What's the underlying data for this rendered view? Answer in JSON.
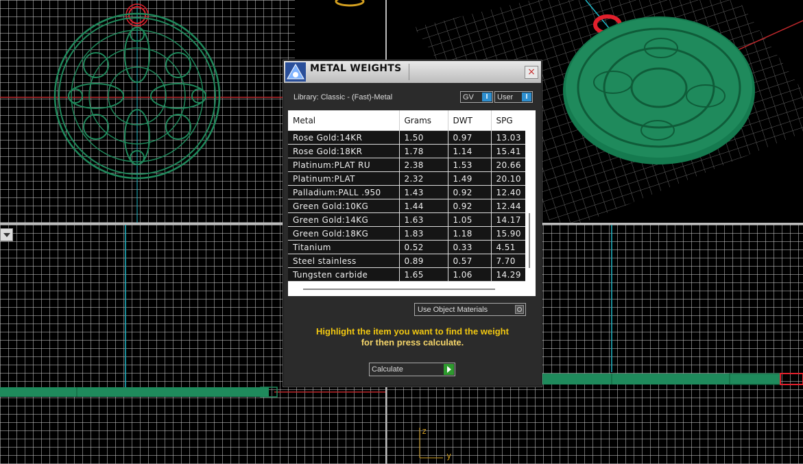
{
  "dialog": {
    "title": "METAL WEIGHTS",
    "close_glyph": "×",
    "library_label": "Library: Classic - (Fast)-Metal",
    "toggle_gv": "GV",
    "toggle_user": "User",
    "toggle_knob": "I",
    "columns": [
      "Metal",
      "Grams",
      "DWT",
      "SPG"
    ],
    "rows": [
      [
        "Rose Gold:14KR",
        "1.50",
        "0.97",
        "13.03"
      ],
      [
        "Rose Gold:18KR",
        "1.78",
        "1.14",
        "15.41"
      ],
      [
        "Platinum:PLAT RU",
        "2.38",
        "1.53",
        "20.66"
      ],
      [
        "Platinum:PLAT",
        "2.32",
        "1.49",
        "20.10"
      ],
      [
        "Palladium:PALL .950",
        "1.43",
        "0.92",
        "12.40"
      ],
      [
        "Green Gold:10KG",
        "1.44",
        "0.92",
        "12.44"
      ],
      [
        "Green Gold:14KG",
        "1.63",
        "1.05",
        "14.17"
      ],
      [
        "Green Gold:18KG",
        "1.83",
        "1.18",
        "15.90"
      ],
      [
        "Titanium",
        "0.52",
        "0.33",
        "4.51"
      ],
      [
        "Steel stainless",
        "0.89",
        "0.57",
        "7.70"
      ],
      [
        "Tungsten carbide",
        "1.65",
        "1.06",
        "14.29"
      ]
    ],
    "object_materials_label": "Use Object Materials",
    "instruction_line1": "Highlight the item you want to find the weight",
    "instruction_line2": "for then press calculate.",
    "calculate_label": "Calculate"
  },
  "viewports": {
    "axis_z": "z",
    "axis_y": "y"
  },
  "colors": {
    "model_green": "#1f8a5c",
    "bail_red": "#e0202c",
    "axis_red": "#c0282c",
    "axis_cyan": "#1fb8c8",
    "instruction_yellow": "#f2c811",
    "toggle_blue": "#2e8fcf",
    "calc_green": "#2e9b2e"
  },
  "icons": [
    "app-logo-icon",
    "close-icon",
    "dropdown-arrow-icon",
    "radio-icon",
    "play-icon"
  ]
}
